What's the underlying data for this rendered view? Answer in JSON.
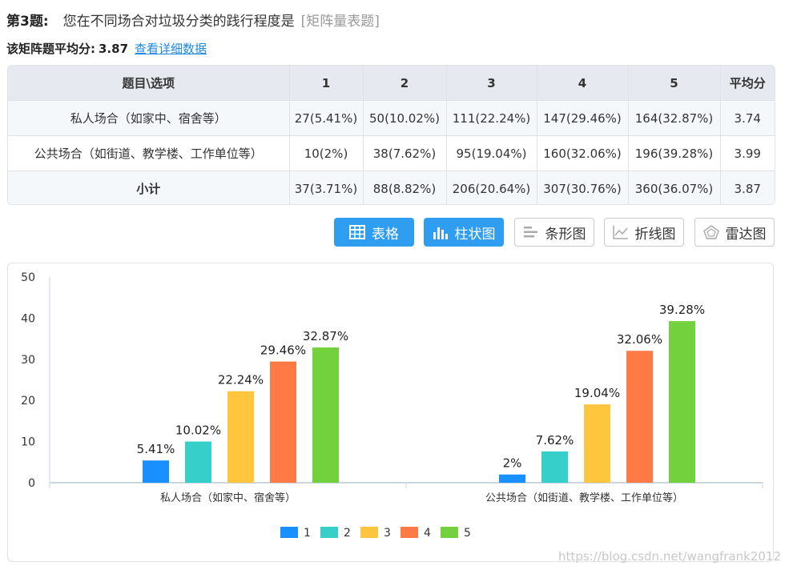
{
  "question": {
    "number_label": "第3题:",
    "text": "您在不同场合对垃圾分类的践行程度是",
    "type_label": "[矩阵量表题]"
  },
  "summary": {
    "avg_label": "该矩阵题平均分:",
    "avg_value": "3.87",
    "detail_link": "查看详细数据"
  },
  "table": {
    "headers": [
      "题目\\选项",
      "1",
      "2",
      "3",
      "4",
      "5",
      "平均分"
    ],
    "rows": [
      [
        "私人场合（如家中、宿舍等）",
        "27(5.41%)",
        "50(10.02%)",
        "111(22.24%)",
        "147(29.46%)",
        "164(32.87%)",
        "3.74"
      ],
      [
        "公共场合（如街道、教学楼、工作单位等）",
        "10(2%)",
        "38(7.62%)",
        "95(19.04%)",
        "160(32.06%)",
        "196(39.28%)",
        "3.99"
      ]
    ],
    "subtotal": [
      "小计",
      "37(3.71%)",
      "88(8.82%)",
      "206(20.64%)",
      "307(30.76%)",
      "360(36.07%)",
      "3.87"
    ]
  },
  "buttons": [
    {
      "label": "表格",
      "icon": "table-icon",
      "active": true
    },
    {
      "label": "柱状图",
      "icon": "bar-chart-icon",
      "active": true
    },
    {
      "label": "条形图",
      "icon": "horizontal-bar-icon",
      "active": false
    },
    {
      "label": "折线图",
      "icon": "line-chart-icon",
      "active": false
    },
    {
      "label": "雷达图",
      "icon": "radar-chart-icon",
      "active": false
    }
  ],
  "chart_data": {
    "type": "bar",
    "categories": [
      "私人场合（如家中、宿舍等）",
      "公共场合（如街道、教学楼、工作单位等）"
    ],
    "series": [
      {
        "name": "1",
        "values": [
          5.41,
          2
        ],
        "labels": [
          "5.41%",
          "2%"
        ],
        "color": "#1890ff"
      },
      {
        "name": "2",
        "values": [
          10.02,
          7.62
        ],
        "labels": [
          "10.02%",
          "7.62%"
        ],
        "color": "#36cfc9"
      },
      {
        "name": "3",
        "values": [
          22.24,
          19.04
        ],
        "labels": [
          "22.24%",
          "19.04%"
        ],
        "color": "#ffc53d"
      },
      {
        "name": "4",
        "values": [
          29.46,
          32.06
        ],
        "labels": [
          "29.46%",
          "32.06%"
        ],
        "color": "#ff7a45"
      },
      {
        "name": "5",
        "values": [
          32.87,
          39.28
        ],
        "labels": [
          "32.87%",
          "39.28%"
        ],
        "color": "#73d13d"
      }
    ],
    "yticks": [
      0,
      10,
      20,
      30,
      40,
      50
    ],
    "ylim": [
      0,
      50
    ],
    "grid": false,
    "legend_position": "bottom"
  },
  "watermark": "https://blog.csdn.net/wangfrank2012"
}
